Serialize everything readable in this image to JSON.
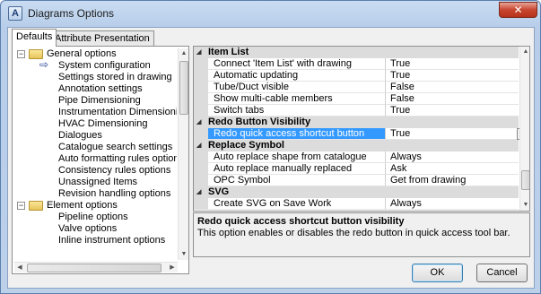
{
  "window": {
    "title": "Diagrams Options",
    "close_glyph": "✕"
  },
  "tabs": [
    "Defaults",
    "Attribute Presentation"
  ],
  "tree": [
    {
      "label": "General options",
      "level": 0,
      "expander": "−",
      "icon": "folder-icon"
    },
    {
      "label": "System configuration",
      "level": 1,
      "icon": "arrow-pointer-icon"
    },
    {
      "label": "Settings stored in drawing",
      "level": 1
    },
    {
      "label": "Annotation settings",
      "level": 1
    },
    {
      "label": "Pipe Dimensioning",
      "level": 1
    },
    {
      "label": "Instrumentation Dimensioning",
      "level": 1
    },
    {
      "label": "HVAC Dimensioning",
      "level": 1
    },
    {
      "label": "Dialogues",
      "level": 1
    },
    {
      "label": "Catalogue search settings",
      "level": 1
    },
    {
      "label": "Auto formatting rules options",
      "level": 1
    },
    {
      "label": "Consistency rules options",
      "level": 1
    },
    {
      "label": "Unassigned Items",
      "level": 1
    },
    {
      "label": "Revision handling options",
      "level": 1
    },
    {
      "label": "Element options",
      "level": 0,
      "expander": "−",
      "icon": "folder-icon"
    },
    {
      "label": "Pipeline options",
      "level": 1
    },
    {
      "label": "Valve options",
      "level": 1
    },
    {
      "label": "Inline instrument options",
      "level": 1
    }
  ],
  "grid": [
    {
      "type": "category",
      "label": "Item List"
    },
    {
      "type": "item",
      "name": "Connect 'Item List' with drawing",
      "value": "True"
    },
    {
      "type": "item",
      "name": "Automatic updating",
      "value": "True"
    },
    {
      "type": "item",
      "name": "Tube/Duct visible",
      "value": "False"
    },
    {
      "type": "item",
      "name": "Show multi-cable members",
      "value": "False"
    },
    {
      "type": "item",
      "name": "Switch tabs",
      "value": "True"
    },
    {
      "type": "category",
      "label": "Redo Button Visibility"
    },
    {
      "type": "item",
      "name": "Redo quick access shortcut button visibility",
      "value": "True",
      "selected": true
    },
    {
      "type": "category",
      "label": "Replace Symbol"
    },
    {
      "type": "item",
      "name": "Auto replace shape from catalogue",
      "value": "Always"
    },
    {
      "type": "item",
      "name": "Auto replace manually replaced shapes",
      "value": "Ask"
    },
    {
      "type": "item",
      "name": "OPC Symbol",
      "value": "Get from drawing"
    },
    {
      "type": "category",
      "label": "SVG"
    },
    {
      "type": "item",
      "name": "Create SVG on Save Work",
      "value": "Always"
    }
  ],
  "help": {
    "title": "Redo quick access shortcut button visibility",
    "description": "This option enables or disables the redo button in quick access tool bar."
  },
  "buttons": {
    "ok": "OK",
    "cancel": "Cancel"
  },
  "colors": {
    "selection": "#3399ff",
    "category_bg": "#dcdcdc"
  }
}
